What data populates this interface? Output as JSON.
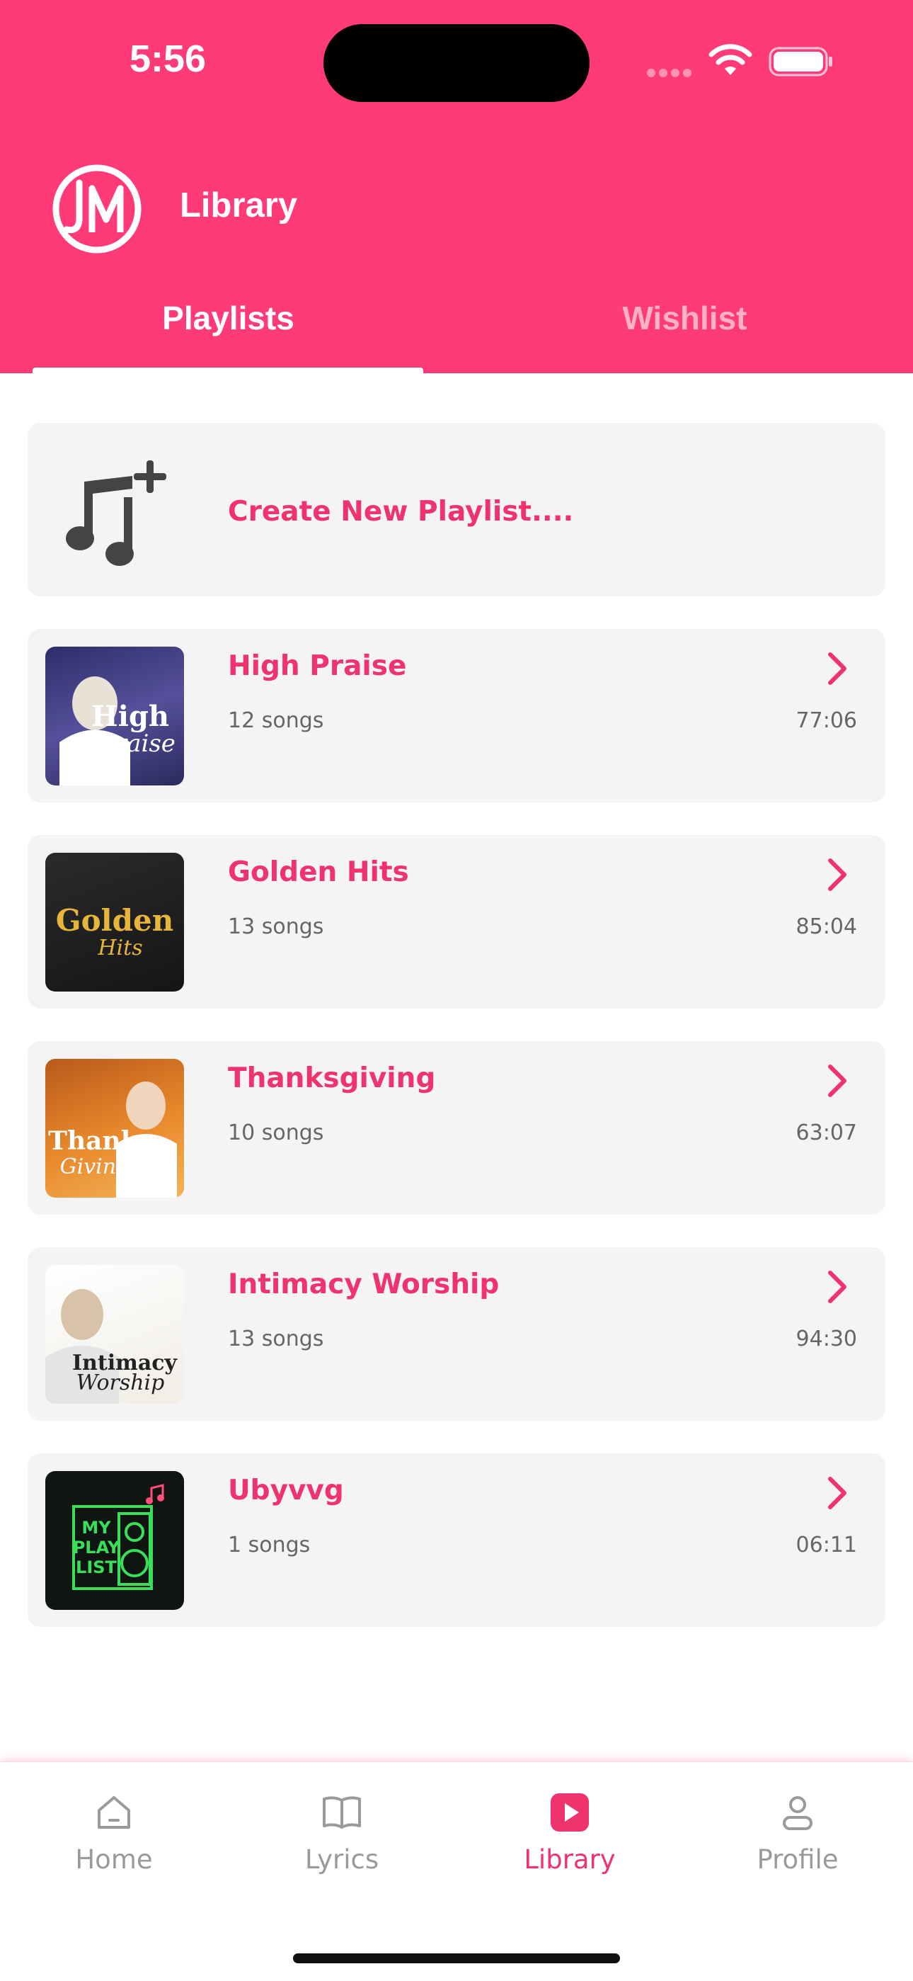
{
  "status": {
    "time": "5:56"
  },
  "header": {
    "title": "Library",
    "logo_text": "JM"
  },
  "tabs": [
    {
      "label": "Playlists",
      "active": true
    },
    {
      "label": "Wishlist",
      "active": false
    }
  ],
  "create": {
    "label": "Create New Playlist....",
    "icon": "music-note-plus-icon"
  },
  "playlists": [
    {
      "name": "High Praise",
      "count": "12 songs",
      "duration": "77:06",
      "cover": {
        "line1": "High",
        "line2": "Praise"
      }
    },
    {
      "name": "Golden Hits",
      "count": "13 songs",
      "duration": "85:04",
      "cover": {
        "line1": "Golden",
        "line2": "Hits"
      }
    },
    {
      "name": "Thanksgiving",
      "count": "10 songs",
      "duration": "63:07",
      "cover": {
        "line1": "Thanks",
        "line2": "Giving"
      }
    },
    {
      "name": "Intimacy Worship",
      "count": "13 songs",
      "duration": "94:30",
      "cover": {
        "line1": "Intimacy",
        "line2": "Worship"
      }
    },
    {
      "name": "Ubyvvg",
      "count": "1 songs",
      "duration": "06:11",
      "cover": {
        "line1": "MY",
        "line2": "PLAY",
        "line3": "LIST"
      }
    }
  ],
  "nav": [
    {
      "label": "Home",
      "icon": "home-icon",
      "active": false
    },
    {
      "label": "Lyrics",
      "icon": "book-icon",
      "active": false
    },
    {
      "label": "Library",
      "icon": "play-square-icon",
      "active": true
    },
    {
      "label": "Profile",
      "icon": "person-icon",
      "active": false
    }
  ],
  "colors": {
    "brand": "#ff3a78",
    "accent_text": "#ee336f",
    "card_bg": "#f4f4f5"
  }
}
